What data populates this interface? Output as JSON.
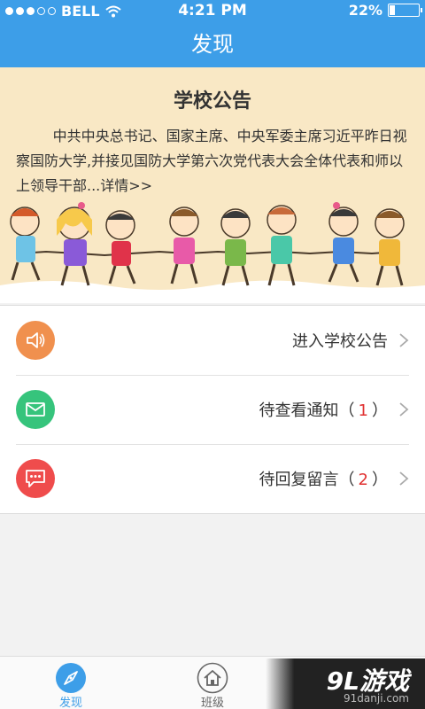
{
  "status": {
    "carrier": "BELL",
    "time": "4:21 PM",
    "battery": "22%",
    "battery_level": 0.22
  },
  "nav": {
    "title": "发现"
  },
  "notice": {
    "title": "学校公告",
    "text": "中共中央总书记、国家主席、中央军委主席习近平昨日视察国防大学,并接见国防大学第六次党代表大会全体代表和师以上领导干部...详情>>"
  },
  "menu": {
    "announcement": {
      "label": "进入学校公告",
      "icon": "speaker-icon",
      "color": "#f0904e"
    },
    "notifications": {
      "label": "待查看通知（",
      "count": "1",
      "suffix": "）",
      "icon": "mail-icon",
      "color": "#36c47c"
    },
    "messages": {
      "label": "待回复留言（",
      "count": "2",
      "suffix": "）",
      "icon": "chat-icon",
      "color": "#ef4c4c"
    }
  },
  "tabs": [
    {
      "label": "发现",
      "icon": "compass-icon",
      "active": true
    },
    {
      "label": "班级",
      "icon": "home-icon",
      "active": false
    }
  ],
  "watermark": {
    "brand": "9L游戏",
    "site": "91danji.com"
  },
  "colors": {
    "accent": "#3d9ee8",
    "banner_bg": "#f9e8c5",
    "count_red": "#e03131"
  }
}
